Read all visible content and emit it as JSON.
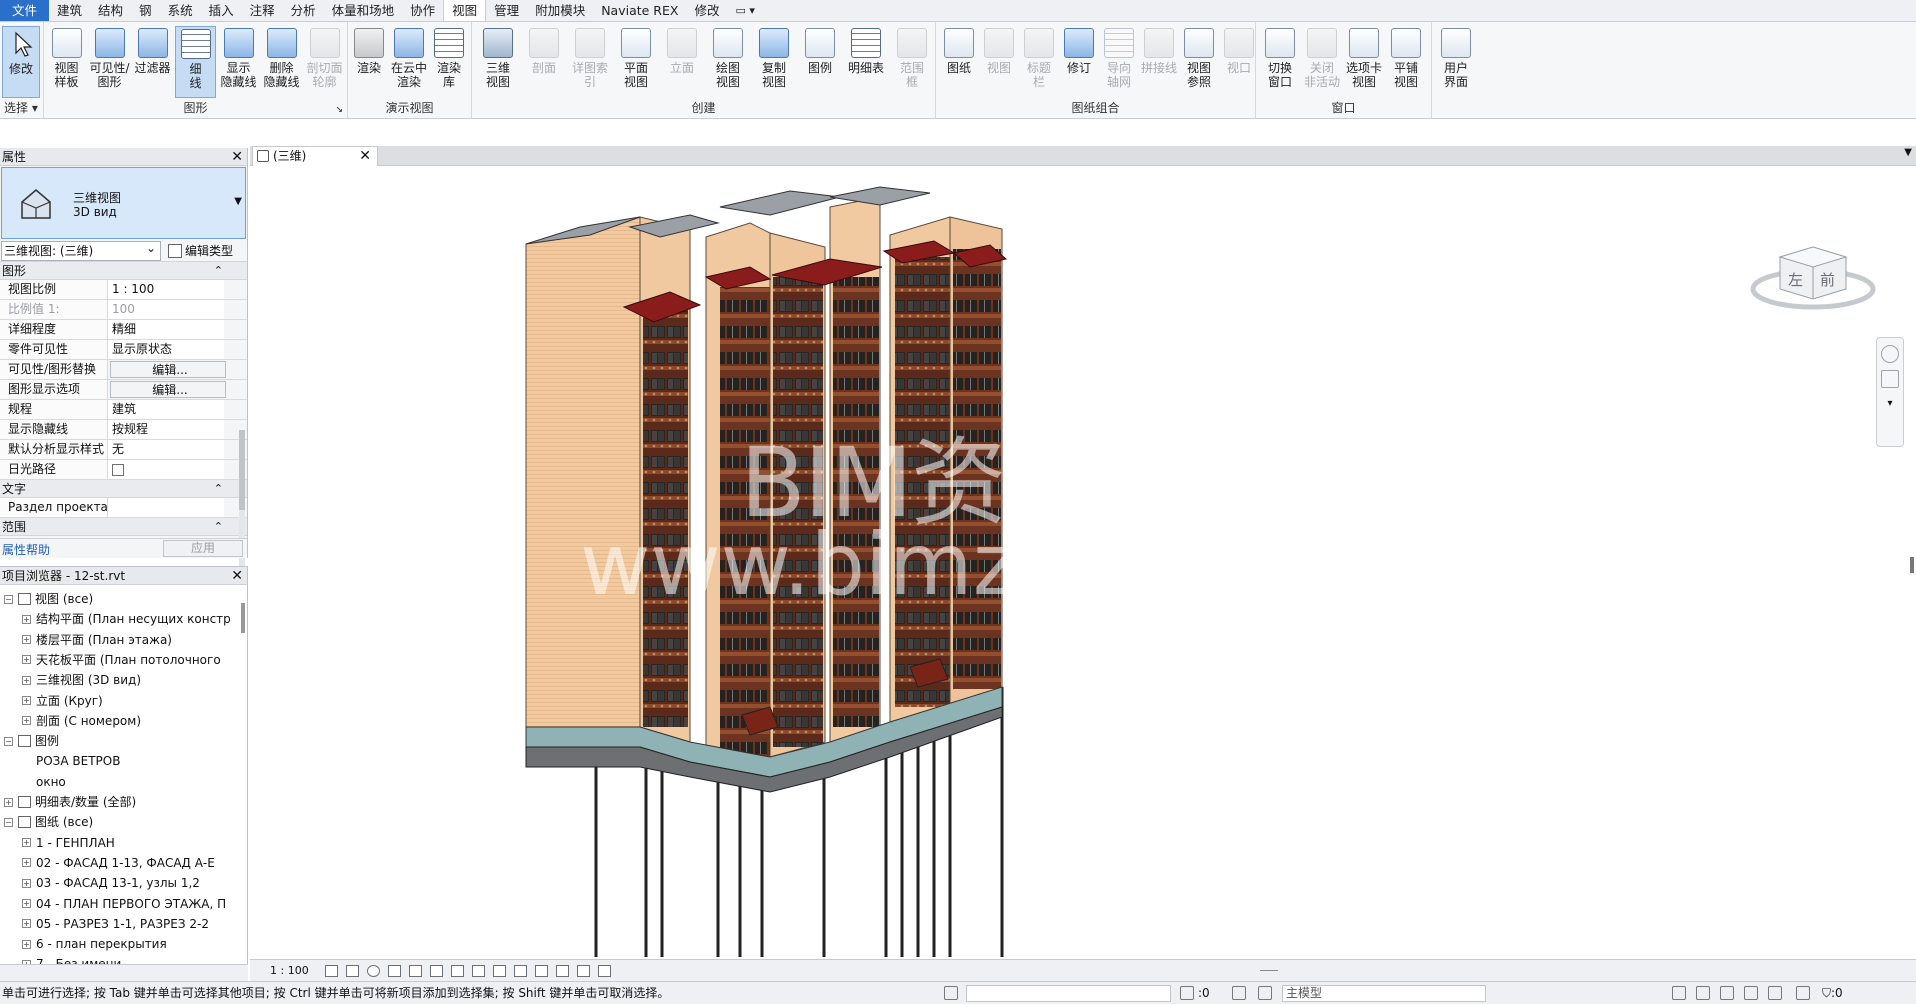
{
  "menubar": {
    "tabs": [
      "文件",
      "建筑",
      "结构",
      "钢",
      "系统",
      "插入",
      "注释",
      "分析",
      "体量和场地",
      "协作",
      "视图",
      "管理",
      "附加模块",
      "Naviate REX",
      "修改"
    ],
    "active_tab": "视图",
    "toggle": "▭ ▾"
  },
  "ribbon": {
    "select": {
      "modify": "修改",
      "label": "选择 ▾"
    },
    "graphics": {
      "buttons": [
        "视图\n样板",
        "可见性/\n图形",
        "过滤器",
        "细\n线",
        "显示\n隐藏线",
        "删除\n隐藏线",
        "剖切面\n轮廓"
      ],
      "label": "图形"
    },
    "presentation": {
      "buttons": [
        "渲染",
        "在云中\n渲染",
        "渲染\n库"
      ],
      "label": "演示视图"
    },
    "create": {
      "buttons": [
        "三维\n视图",
        "剖面",
        "详图索引",
        "平面\n视图",
        "立面",
        "绘图\n视图",
        "复制\n视图",
        "图例",
        "明细表",
        "范围\n框"
      ],
      "label": "创建"
    },
    "sheet": {
      "buttons": [
        "图纸",
        "视图",
        "标题\n栏",
        "修订",
        "导向\n轴网",
        "拼接线",
        "视图\n参照",
        "视口"
      ],
      "label": "图纸组合"
    },
    "window": {
      "buttons": [
        "切换\n窗口",
        "关闭\n非活动",
        "选项卡\n视图",
        "平铺\n视图"
      ],
      "label": "窗口"
    },
    "ui": {
      "button": "用户\n界面"
    }
  },
  "properties": {
    "title": "属性",
    "type_name_1": "三维视图",
    "type_name_2": "3D вид",
    "instance_selector": "三维视图: (三维)",
    "edit_type": "编辑类型",
    "sections": [
      {
        "name": "图形",
        "rows": [
          {
            "k": "视图比例",
            "v": "1 : 100",
            "kind": "text"
          },
          {
            "k": "比例值 1:",
            "v": "100",
            "kind": "dim"
          },
          {
            "k": "详细程度",
            "v": "精细",
            "kind": "text"
          },
          {
            "k": "零件可见性",
            "v": "显示原状态",
            "kind": "text"
          },
          {
            "k": "可见性/图形替换",
            "v": "编辑...",
            "kind": "btn"
          },
          {
            "k": "图形显示选项",
            "v": "编辑...",
            "kind": "btn"
          },
          {
            "k": "规程",
            "v": "建筑",
            "kind": "text"
          },
          {
            "k": "显示隐藏线",
            "v": "按规程",
            "kind": "text"
          },
          {
            "k": "默认分析显示样式",
            "v": "无",
            "kind": "text"
          },
          {
            "k": "日光路径",
            "v": "",
            "kind": "check"
          }
        ]
      },
      {
        "name": "文字",
        "rows": [
          {
            "k": "Раздел проекта",
            "v": "",
            "kind": "text"
          }
        ]
      },
      {
        "name": "范围",
        "rows": []
      }
    ],
    "help_link": "属性帮助",
    "apply": "应用"
  },
  "browser": {
    "title": "项目浏览器 - 12-st.rvt",
    "nodes": [
      {
        "level": 0,
        "pm": "−",
        "icon": true,
        "text": "视图 (все)"
      },
      {
        "level": 1,
        "pm": "+",
        "icon": false,
        "text": "结构平面 (План несущих констр"
      },
      {
        "level": 1,
        "pm": "+",
        "icon": false,
        "text": "楼层平面 (План этажа)"
      },
      {
        "level": 1,
        "pm": "+",
        "icon": false,
        "text": "天花板平面 (План потолочного"
      },
      {
        "level": 1,
        "pm": "+",
        "icon": false,
        "text": "三维视图 (3D вид)"
      },
      {
        "level": 1,
        "pm": "+",
        "icon": false,
        "text": "立面 (Круг)"
      },
      {
        "level": 1,
        "pm": "+",
        "icon": false,
        "text": "剖面 (С номером)"
      },
      {
        "level": 0,
        "pm": "−",
        "icon": true,
        "text": "图例"
      },
      {
        "level": 1,
        "pm": "",
        "icon": false,
        "text": "РОЗА ВЕТРОВ"
      },
      {
        "level": 1,
        "pm": "",
        "icon": false,
        "text": "окно"
      },
      {
        "level": 0,
        "pm": "+",
        "icon": true,
        "text": "明细表/数量 (全部)"
      },
      {
        "level": 0,
        "pm": "−",
        "icon": true,
        "text": "图纸 (все)"
      },
      {
        "level": 1,
        "pm": "+",
        "icon": false,
        "text": "1 - ГЕНПЛАН"
      },
      {
        "level": 1,
        "pm": "+",
        "icon": false,
        "text": "02 - ФАСАД 1-13, ФАСАД А-Е"
      },
      {
        "level": 1,
        "pm": "+",
        "icon": false,
        "text": "03 - ФАСАД 13-1, узлы 1,2"
      },
      {
        "level": 1,
        "pm": "+",
        "icon": false,
        "text": "04 - ПЛАН ПЕРВОГО ЭТАЖА, П"
      },
      {
        "level": 1,
        "pm": "+",
        "icon": false,
        "text": "05 - РАЗРЕЗ 1-1, РАЗРЕЗ 2-2"
      },
      {
        "level": 1,
        "pm": "+",
        "icon": false,
        "text": "6 - план перекрытия"
      },
      {
        "level": 1,
        "pm": "+",
        "icon": false,
        "text": "7 - Без имени"
      }
    ]
  },
  "view_tab": {
    "label": "(三维)"
  },
  "canvas": {
    "watermark_1": "BIM资源网",
    "watermark_2": "www.bimzyw.com",
    "viewcube_left": "左",
    "viewcube_front": "前"
  },
  "view_control": {
    "scale": "1 : 100"
  },
  "status": {
    "message": "单击可进行选择; 按 Tab 键并单击可选择其他项目; 按 Ctrl 键并单击可将新项目添加到选择集; 按 Shift 键并单击可取消选择。",
    "count_a": ":0",
    "model": "主模型",
    "filter": ":0"
  },
  "colors": {
    "file_tab": "#2a6fc9",
    "facade_light": "#f0c9a0",
    "facade_brick": "#7a3a22",
    "roof": "#8a1c1c",
    "selection": "#c6dcf5"
  }
}
